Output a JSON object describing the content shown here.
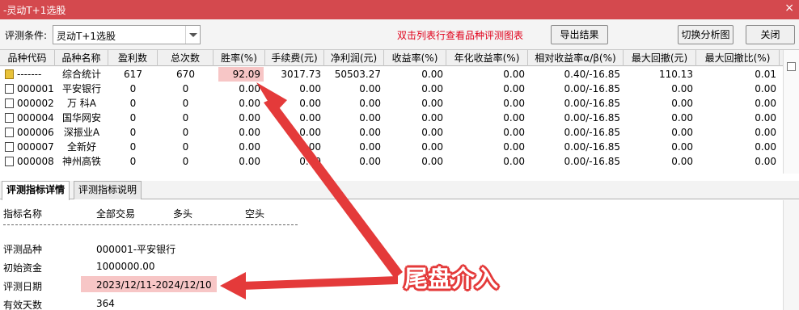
{
  "window": {
    "title": "-灵动T+1选股",
    "close_glyph": "×"
  },
  "toolbar": {
    "condition_label": "评测条件:",
    "condition_value": "灵动T+1选股",
    "hint": "双击列表行查看品种评测图表",
    "export_label": "导出结果",
    "switch_label": "切换分析图",
    "close_label": "关闭"
  },
  "grid": {
    "headers": [
      "品种代码",
      "品种名称",
      "盈利数",
      "总次数",
      "胜率(%)",
      "手续费(元)",
      "净利润(元)",
      "收益率(%)",
      "年化收益率(%)",
      "相对收益率α/β(%)",
      "最大回撤(元)",
      "最大回撤比(%)"
    ],
    "rows": [
      {
        "code": "-------",
        "name": "综合统计",
        "win": "617",
        "total": "670",
        "rate": "92.09",
        "fee": "3017.73",
        "profit": "50503.27",
        "ret": "0.00",
        "annual": "0.00",
        "alpha": "0.40/-16.85",
        "dd": "110.13",
        "ddr": "0.01"
      },
      {
        "code": "000001",
        "name": "平安银行",
        "win": "0",
        "total": "0",
        "rate": "0.00",
        "fee": "0.00",
        "profit": "0.00",
        "ret": "0.00",
        "annual": "0.00",
        "alpha": "0.00/-16.85",
        "dd": "0.00",
        "ddr": "0.00"
      },
      {
        "code": "000002",
        "name": "万 科A",
        "win": "0",
        "total": "0",
        "rate": "0.00",
        "fee": "0.00",
        "profit": "0.00",
        "ret": "0.00",
        "annual": "0.00",
        "alpha": "0.00/-16.85",
        "dd": "0.00",
        "ddr": "0.00"
      },
      {
        "code": "000004",
        "name": "国华网安",
        "win": "0",
        "total": "0",
        "rate": "0.00",
        "fee": "0.00",
        "profit": "0.00",
        "ret": "0.00",
        "annual": "0.00",
        "alpha": "0.00/-16.85",
        "dd": "0.00",
        "ddr": "0.00"
      },
      {
        "code": "000006",
        "name": "深振业A",
        "win": "0",
        "total": "0",
        "rate": "0.00",
        "fee": "0.00",
        "profit": "0.00",
        "ret": "0.00",
        "annual": "0.00",
        "alpha": "0.00/-16.85",
        "dd": "0.00",
        "ddr": "0.00"
      },
      {
        "code": "000007",
        "name": "全新好",
        "win": "0",
        "total": "0",
        "rate": "0.00",
        "fee": "0.00",
        "profit": "0.00",
        "ret": "0.00",
        "annual": "0.00",
        "alpha": "0.00/-16.85",
        "dd": "0.00",
        "ddr": "0.00"
      },
      {
        "code": "000008",
        "name": "神州高铁",
        "win": "0",
        "total": "0",
        "rate": "0.00",
        "fee": "0.00",
        "profit": "0.00",
        "ret": "0.00",
        "annual": "0.00",
        "alpha": "0.00/-16.85",
        "dd": "0.00",
        "ddr": "0.00"
      }
    ]
  },
  "tabs": [
    "评测指标详情",
    "评测指标说明"
  ],
  "detail": {
    "col_name": "指标名称",
    "col_all": "全部交易",
    "col_long": "多头",
    "col_short": "空头",
    "items": [
      {
        "label": "评测品种",
        "value": "000001-平安银行"
      },
      {
        "label": "初始资金",
        "value": "1000000.00"
      },
      {
        "label": "评测日期",
        "value": "2023/12/11-2024/12/10"
      },
      {
        "label": "有效天数",
        "value": "364"
      }
    ]
  },
  "annotation": {
    "text": "尾盘介入",
    "color": "#e43a3a"
  },
  "colors": {
    "titlebar": "#d4494e",
    "hint": "#e0001a",
    "highlight": "#f7c6c6"
  },
  "icons": {
    "summary_row": "folder-icon",
    "stock_row": "file-icon"
  }
}
